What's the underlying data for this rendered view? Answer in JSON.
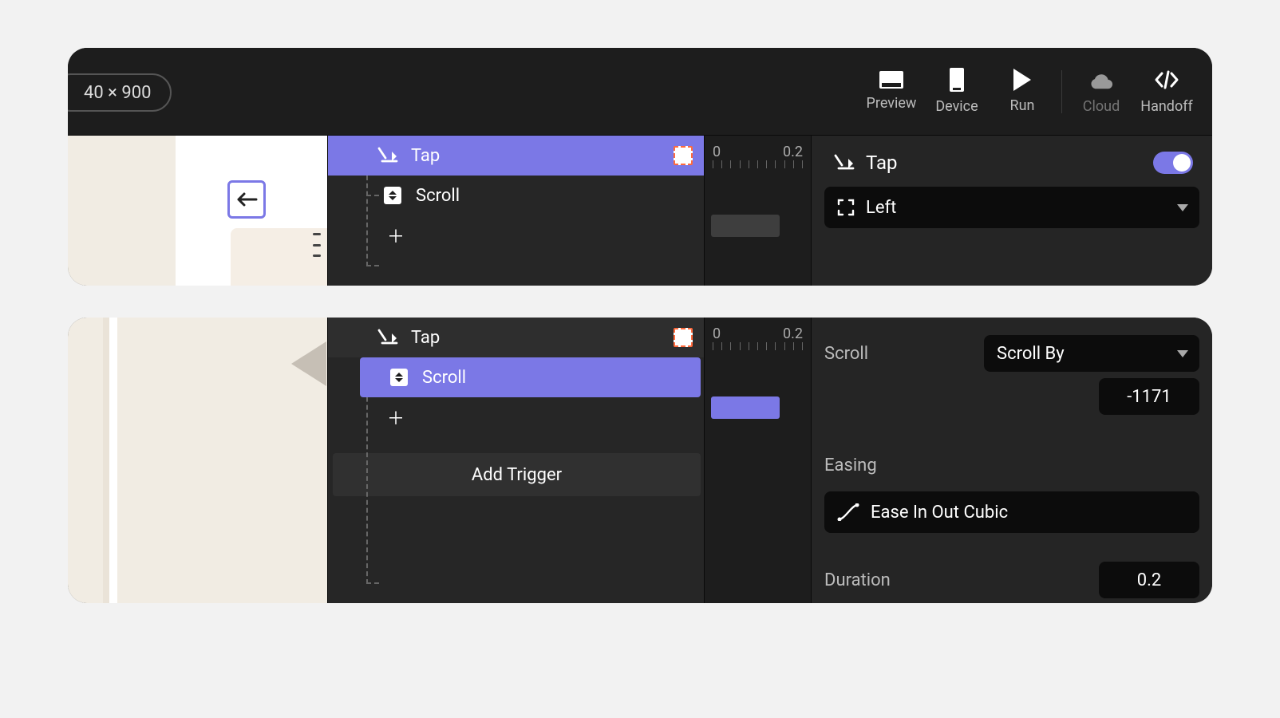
{
  "toolbar": {
    "dimensions": "40 × 900",
    "preview": "Preview",
    "device": "Device",
    "run": "Run",
    "cloud": "Cloud",
    "handoff": "Handoff"
  },
  "panel1": {
    "tap_label": "Tap",
    "scroll_label": "Scroll",
    "timeline": {
      "t0": "0",
      "t1": "0.2"
    },
    "inspector": {
      "title": "Tap",
      "target_option": "Left"
    }
  },
  "panel2": {
    "tap_label": "Tap",
    "scroll_label": "Scroll",
    "timeline": {
      "t0": "0",
      "t1": "0.2"
    },
    "add_trigger": "Add Trigger",
    "inspector": {
      "scroll_label": "Scroll",
      "scroll_mode": "Scroll By",
      "scroll_value": "-1171",
      "easing_label": "Easing",
      "easing_value": "Ease In Out Cubic",
      "duration_label": "Duration",
      "duration_value": "0.2"
    }
  }
}
